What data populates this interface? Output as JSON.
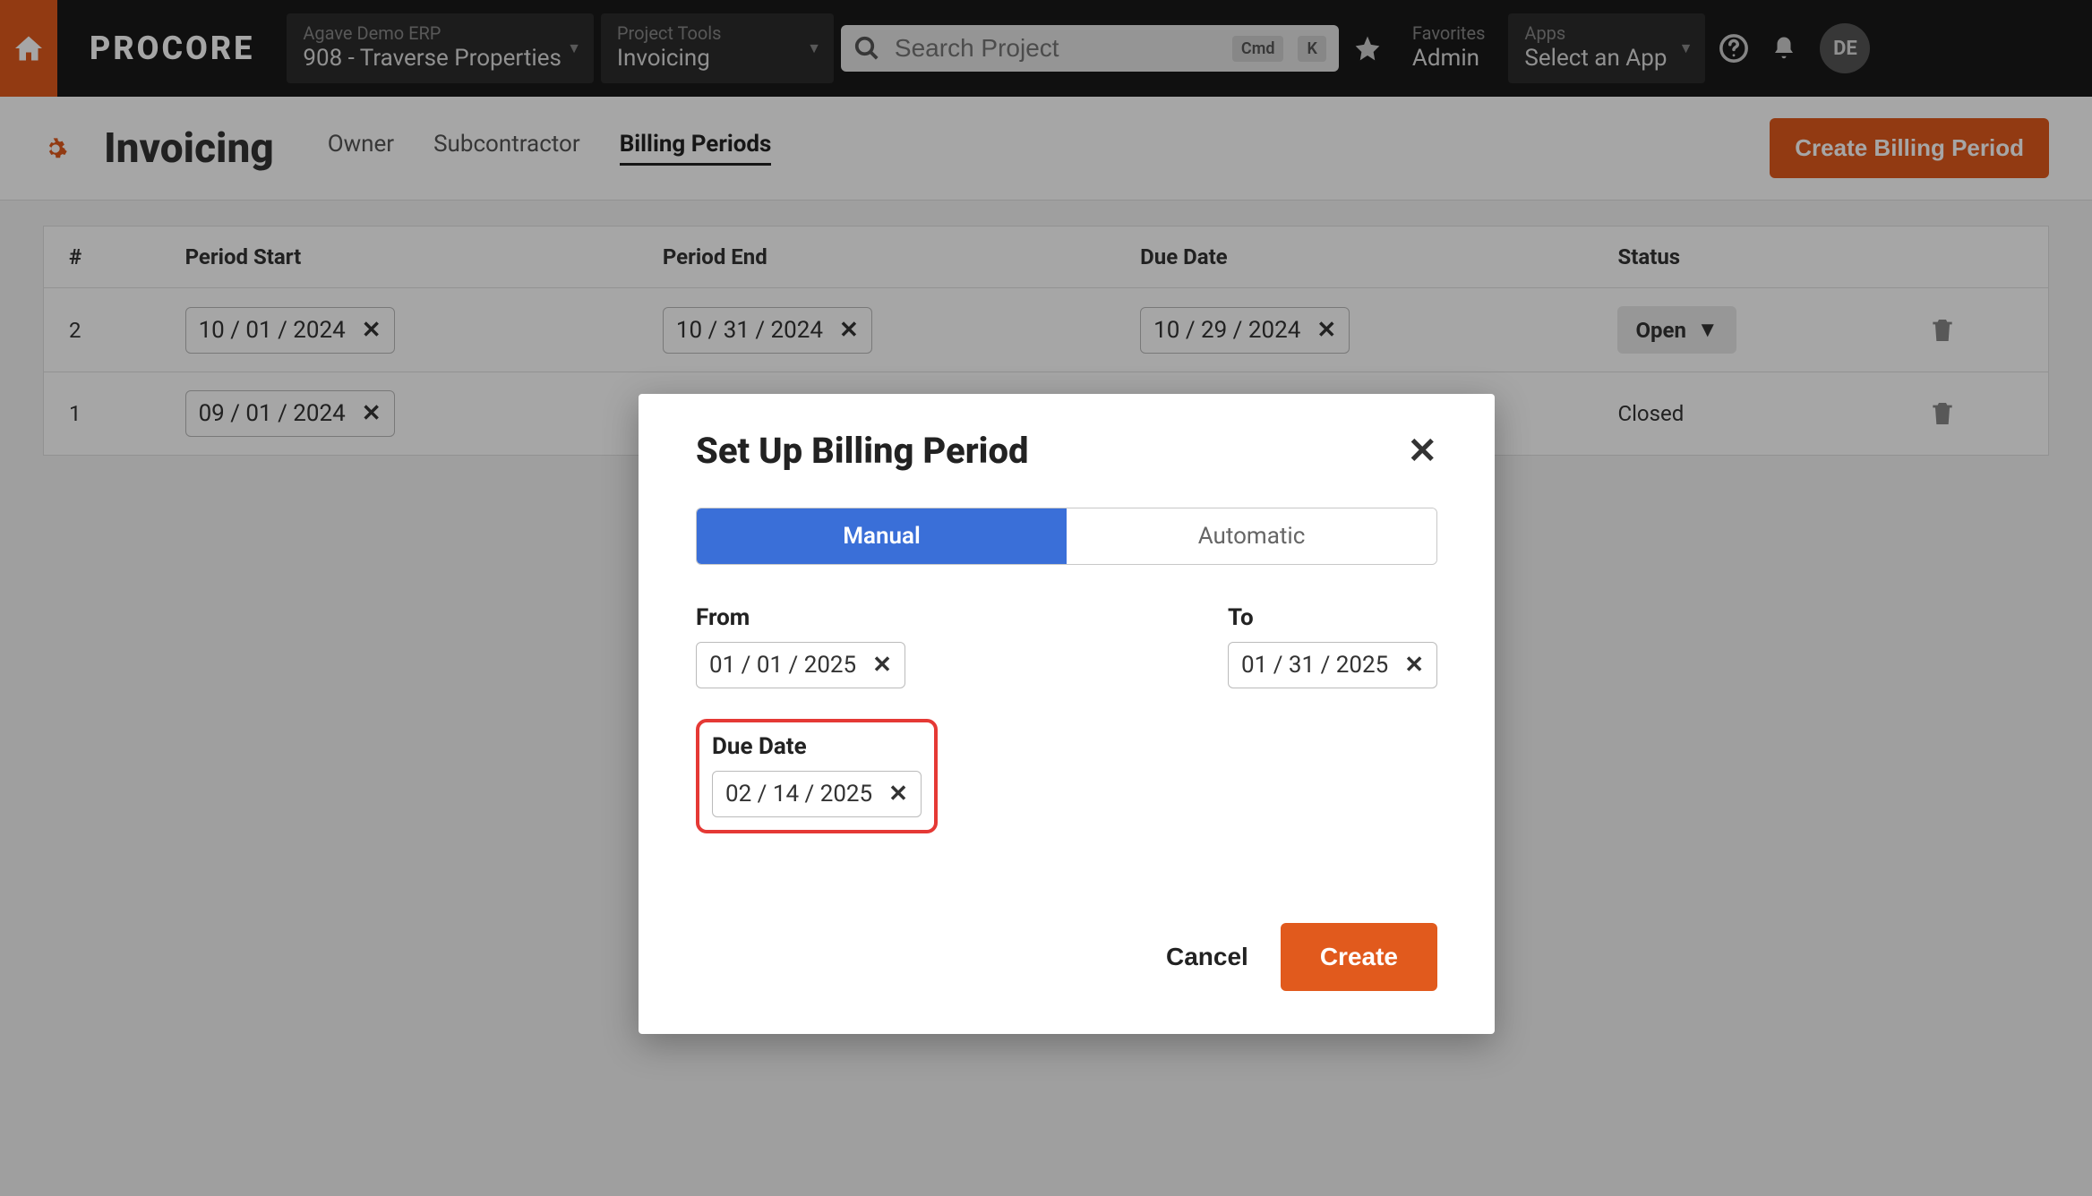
{
  "nav": {
    "logo": "PROCORE",
    "erp_label": "Agave Demo ERP",
    "erp_value": "908 - Traverse Properties",
    "tools_label": "Project Tools",
    "tools_value": "Invoicing",
    "search_placeholder": "Search Project",
    "kbd1": "Cmd",
    "kbd2": "K",
    "fav_label": "Favorites",
    "fav_value": "Admin",
    "apps_label": "Apps",
    "apps_value": "Select an App",
    "avatar": "DE"
  },
  "header": {
    "title": "Invoicing",
    "tabs": [
      "Owner",
      "Subcontractor",
      "Billing Periods"
    ],
    "active_tab": 2,
    "create_button": "Create Billing Period"
  },
  "table": {
    "columns": [
      "#",
      "Period Start",
      "Period End",
      "Due Date",
      "Status",
      ""
    ],
    "rows": [
      {
        "num": "2",
        "start": "10 / 01 / 2024",
        "end": "10 / 31 / 2024",
        "due": "10 / 29 / 2024",
        "status": "Open"
      },
      {
        "num": "1",
        "start": "09 / 01 / 2024",
        "end": "",
        "due": "",
        "status": "Closed"
      }
    ]
  },
  "modal": {
    "title": "Set Up Billing Period",
    "seg_manual": "Manual",
    "seg_auto": "Automatic",
    "from_label": "From",
    "from_value": "01 / 01 / 2025",
    "to_label": "To",
    "to_value": "01 / 31 / 2025",
    "due_label": "Due Date",
    "due_value": "02 / 14 / 2025",
    "cancel": "Cancel",
    "create": "Create"
  }
}
